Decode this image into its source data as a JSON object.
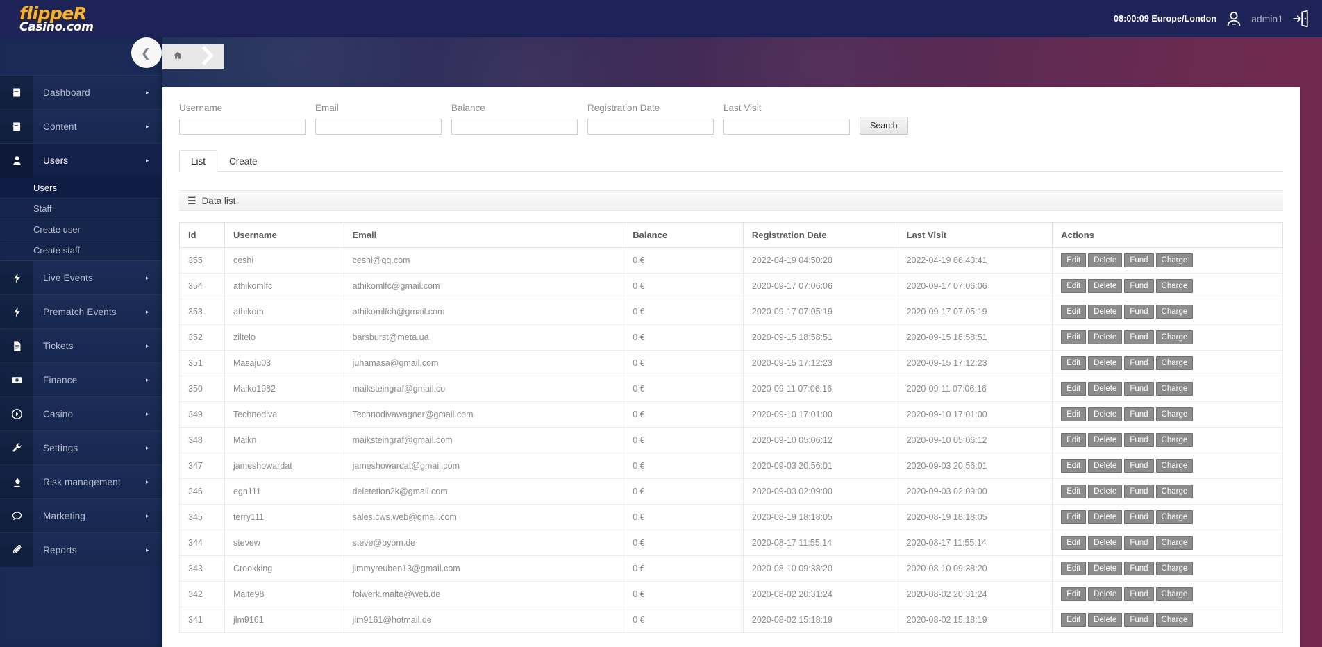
{
  "brand": {
    "line1": "flippeR",
    "line2": "Casino.com"
  },
  "topbar": {
    "clock": "08:00:09 Europe/London",
    "username": "admin1",
    "avatar_icon": "user-avatar-icon",
    "logout_icon": "logout-icon"
  },
  "sidebar": {
    "collapse_icon": "chevron-left-icon",
    "items": [
      {
        "label": "Dashboard",
        "icon": "book-icon",
        "caret": "▸",
        "active": false
      },
      {
        "label": "Content",
        "icon": "book-icon",
        "caret": "▸",
        "active": false
      },
      {
        "label": "Users",
        "icon": "user-icon",
        "caret": "▸",
        "active": true
      },
      {
        "label": "Live Events",
        "icon": "bolt-icon",
        "caret": "▸",
        "active": false
      },
      {
        "label": "Prematch Events",
        "icon": "bolt-icon",
        "caret": "▸",
        "active": false
      },
      {
        "label": "Tickets",
        "icon": "file-icon",
        "caret": "▸",
        "active": false
      },
      {
        "label": "Finance",
        "icon": "money-icon",
        "caret": "▸",
        "active": false
      },
      {
        "label": "Casino",
        "icon": "play-circle-icon",
        "caret": "▸",
        "active": false
      },
      {
        "label": "Settings",
        "icon": "wrench-icon",
        "caret": "▸",
        "active": false
      },
      {
        "label": "Risk management",
        "icon": "fire-icon",
        "caret": "▸",
        "active": false
      },
      {
        "label": "Marketing",
        "icon": "comment-icon",
        "caret": "▸",
        "active": false
      },
      {
        "label": "Reports",
        "icon": "paperclip-icon",
        "caret": "▸",
        "active": false
      }
    ],
    "users_submenu": [
      {
        "label": "Users",
        "selected": true
      },
      {
        "label": "Staff",
        "selected": false
      },
      {
        "label": "Create user",
        "selected": false
      },
      {
        "label": "Create staff",
        "selected": false
      }
    ]
  },
  "breadcrumb": {
    "home_icon": "home-icon",
    "arrow_icon": "chevron-right-icon"
  },
  "filters": {
    "fields": [
      {
        "label": "Username",
        "value": "",
        "placeholder": ""
      },
      {
        "label": "Email",
        "value": "",
        "placeholder": ""
      },
      {
        "label": "Balance",
        "value": "",
        "placeholder": ""
      },
      {
        "label": "Registration Date",
        "value": "",
        "placeholder": ""
      },
      {
        "label": "Last Visit",
        "value": "",
        "placeholder": ""
      }
    ],
    "search_label": "Search"
  },
  "tabs": [
    {
      "label": "List",
      "active": true
    },
    {
      "label": "Create",
      "active": false
    }
  ],
  "datalist": {
    "burger_icon": "hamburger-icon",
    "title": "Data list"
  },
  "table": {
    "columns": [
      "Id",
      "Username",
      "Email",
      "Balance",
      "Registration Date",
      "Last Visit",
      "Actions"
    ],
    "action_labels": [
      "Edit",
      "Delete",
      "Fund",
      "Charge"
    ],
    "rows": [
      {
        "id": "355",
        "username": "ceshi",
        "email": "ceshi@qq.com",
        "balance": "0 €",
        "registration": "2022-04-19 04:50:20",
        "last_visit": "2022-04-19 06:40:41"
      },
      {
        "id": "354",
        "username": "athikomlfc",
        "email": "athikomlfc@gmail.com",
        "balance": "0 €",
        "registration": "2020-09-17 07:06:06",
        "last_visit": "2020-09-17 07:06:06"
      },
      {
        "id": "353",
        "username": "athikom",
        "email": "athikomlfch@gmail.com",
        "balance": "0 €",
        "registration": "2020-09-17 07:05:19",
        "last_visit": "2020-09-17 07:05:19"
      },
      {
        "id": "352",
        "username": "ziltelo",
        "email": "barsburst@meta.ua",
        "balance": "0 €",
        "registration": "2020-09-15 18:58:51",
        "last_visit": "2020-09-15 18:58:51"
      },
      {
        "id": "351",
        "username": "Masaju03",
        "email": "juhamasa@gmail.com",
        "balance": "0 €",
        "registration": "2020-09-15 17:12:23",
        "last_visit": "2020-09-15 17:12:23"
      },
      {
        "id": "350",
        "username": "Maiko1982",
        "email": "maiksteingraf@gmail.co",
        "balance": "0 €",
        "registration": "2020-09-11 07:06:16",
        "last_visit": "2020-09-11 07:06:16"
      },
      {
        "id": "349",
        "username": "Technodiva",
        "email": "Technodivawagner@gmail.com",
        "balance": "0 €",
        "registration": "2020-09-10 17:01:00",
        "last_visit": "2020-09-10 17:01:00"
      },
      {
        "id": "348",
        "username": "Maikn",
        "email": "maiksteingraf@gmail.com",
        "balance": "0 €",
        "registration": "2020-09-10 05:06:12",
        "last_visit": "2020-09-10 05:06:12"
      },
      {
        "id": "347",
        "username": "jameshowardat",
        "email": "jameshowardat@gmail.com",
        "balance": "0 €",
        "registration": "2020-09-03 20:56:01",
        "last_visit": "2020-09-03 20:56:01"
      },
      {
        "id": "346",
        "username": "egn111",
        "email": "deletetion2k@gmail.com",
        "balance": "0 €",
        "registration": "2020-09-03 02:09:00",
        "last_visit": "2020-09-03 02:09:00"
      },
      {
        "id": "345",
        "username": "terry111",
        "email": "sales.cws.web@gmail.com",
        "balance": "0 €",
        "registration": "2020-08-19 18:18:05",
        "last_visit": "2020-08-19 18:18:05"
      },
      {
        "id": "344",
        "username": "stevew",
        "email": "steve@byom.de",
        "balance": "0 €",
        "registration": "2020-08-17 11:55:14",
        "last_visit": "2020-08-17 11:55:14"
      },
      {
        "id": "343",
        "username": "Crookking",
        "email": "jimmyreuben13@gmail.com",
        "balance": "0 €",
        "registration": "2020-08-10 09:38:20",
        "last_visit": "2020-08-10 09:38:20"
      },
      {
        "id": "342",
        "username": "Malte98",
        "email": "folwerk.malte@web.de",
        "balance": "0 €",
        "registration": "2020-08-02 20:31:24",
        "last_visit": "2020-08-02 20:31:24"
      },
      {
        "id": "341",
        "username": "jlm9161",
        "email": "jlm9161@hotmail.de",
        "balance": "0 €",
        "registration": "2020-08-02 15:18:19",
        "last_visit": "2020-08-02 15:18:19"
      }
    ]
  },
  "colors": {
    "topbar_bg": "#1e2357",
    "sidebar_bg": "#182a55",
    "brand_gold": "#f0b23c",
    "bg_gradient_left": "#1b2d55",
    "bg_gradient_right": "#75284d",
    "action_btn": "#8c8c8c"
  }
}
